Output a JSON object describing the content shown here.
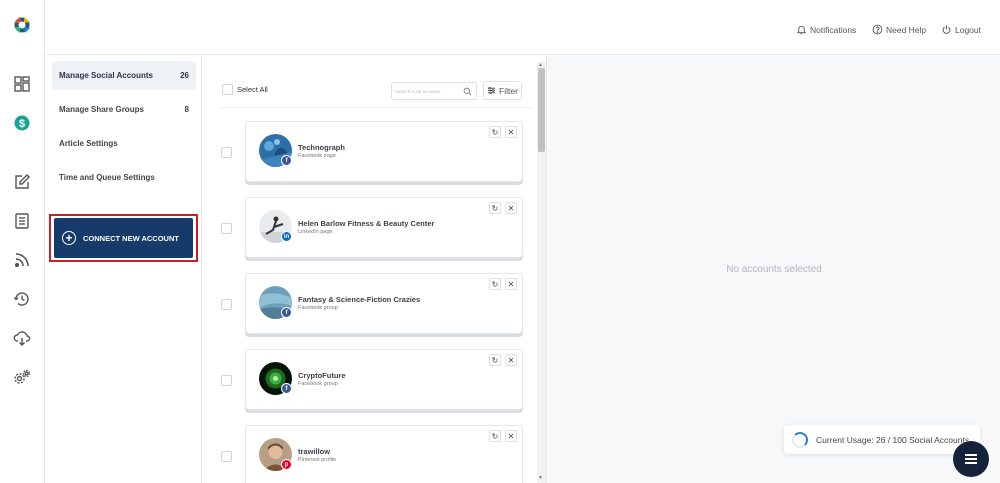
{
  "header": {
    "notifications_label": "Notifications",
    "help_label": "Need Help",
    "logout_label": "Logout"
  },
  "settings_nav": {
    "items": [
      {
        "label": "Manage Social Accounts",
        "count": "26",
        "active": true
      },
      {
        "label": "Manage Share Groups",
        "count": "8",
        "active": false
      },
      {
        "label": "Article Settings",
        "count": "",
        "active": false
      },
      {
        "label": "Time and Queue Settings",
        "count": "",
        "active": false
      }
    ],
    "connect_label": "CONNECT NEW ACCOUNT"
  },
  "accounts": {
    "select_all_label": "Select All",
    "search_placeholder": "Search in 26 accounts",
    "filter_label": "Filter",
    "list": [
      {
        "name": "Technograph",
        "type": "Facebook page",
        "network": "facebook"
      },
      {
        "name": "Helen Barlow Fitness & Beauty Center",
        "type": "LinkedIn page",
        "network": "linkedin"
      },
      {
        "name": "Fantasy & Science-Fiction Crazies",
        "type": "Facebook group",
        "network": "facebook"
      },
      {
        "name": "CryptoFuture",
        "type": "Facebook group",
        "network": "facebook"
      },
      {
        "name": "trawillow",
        "type": "Pinterest profile",
        "network": "pinterest"
      }
    ]
  },
  "preview": {
    "empty_text": "No accounts selected",
    "usage_text": "Current Usage: 26 / 100 Social Accounts"
  },
  "colors": {
    "primary_button": "#163a6a",
    "highlight_outline": "#c4202a",
    "facebook": "#3b5998",
    "linkedin": "#0a66c2",
    "pinterest": "#e60023",
    "fab": "#15233a"
  }
}
